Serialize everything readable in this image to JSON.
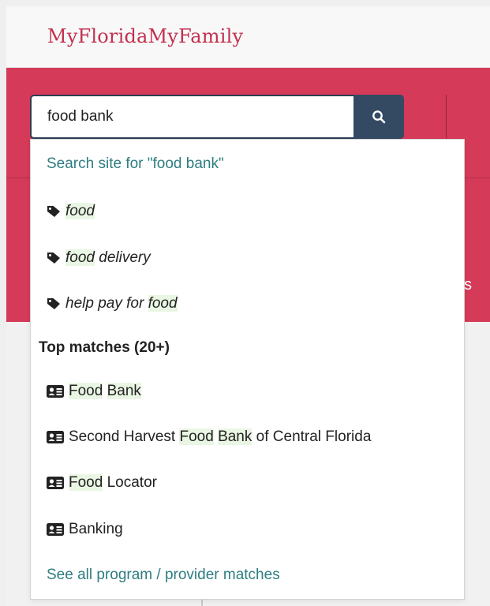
{
  "header": {
    "logo": "MyFloridaMyFamily"
  },
  "hero": {
    "edge_text": "s"
  },
  "search": {
    "value": "food bank",
    "button_icon": "search-icon"
  },
  "dropdown": {
    "search_site": "Search site for \"food bank\"",
    "tags": [
      {
        "icon": "tag-icon",
        "parts": [
          {
            "text": "food",
            "hl": true
          }
        ]
      },
      {
        "icon": "tag-icon",
        "parts": [
          {
            "text": "food",
            "hl": true
          },
          {
            "text": " delivery",
            "hl": false
          }
        ]
      },
      {
        "icon": "tag-icon",
        "parts": [
          {
            "text": "help pay for ",
            "hl": false
          },
          {
            "text": "food",
            "hl": true
          }
        ]
      }
    ],
    "top_matches_heading": "Top matches (20+)",
    "matches": [
      {
        "icon": "id-card-icon",
        "parts": [
          {
            "text": "Food",
            "hl": true
          },
          {
            "text": " ",
            "hl": false
          },
          {
            "text": "Bank",
            "hl": true
          }
        ]
      },
      {
        "icon": "id-card-icon",
        "parts": [
          {
            "text": "Second Harvest ",
            "hl": false
          },
          {
            "text": "Food",
            "hl": true
          },
          {
            "text": " ",
            "hl": false
          },
          {
            "text": "Bank",
            "hl": true
          },
          {
            "text": " of Central Florida",
            "hl": false
          }
        ]
      },
      {
        "icon": "id-card-icon",
        "parts": [
          {
            "text": "Food",
            "hl": true
          },
          {
            "text": " Locator",
            "hl": false
          }
        ]
      },
      {
        "icon": "id-card-icon",
        "parts": [
          {
            "text": "Banking",
            "hl": false
          }
        ]
      }
    ],
    "see_all": "See all program / provider matches"
  },
  "colors": {
    "brand": "#d63a59",
    "logo": "#c3304e",
    "link": "#2e7d80",
    "search_button": "#344a63",
    "highlight": "#eaf6e4"
  }
}
